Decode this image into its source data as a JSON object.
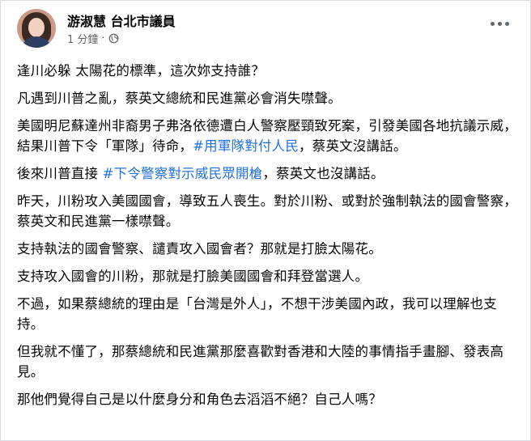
{
  "post": {
    "author": "游淑慧 台北市議員",
    "timestamp": "1 分鐘",
    "separator": "·",
    "privacy_icon": "globe-icon",
    "more_icon": "more-options-icon"
  },
  "paragraphs": [
    {
      "text": "逢川必躲 太陽花的標準，這次妳支持誰？"
    },
    {
      "text": "凡遇到川普之亂，蔡英文總統和民進黨必會消失噤聲。"
    },
    {
      "before": "美國明尼蘇達州非裔男子弗洛依德遭白人警察壓頸致死案，引發美國各地抗議示威，結果川普下令「軍隊」待命，",
      "hashtag": "#用軍隊對付人民",
      "after": "，蔡英文沒講話。"
    },
    {
      "before": "後來川普直接 ",
      "hashtag": "#下令警察對示威民眾開槍",
      "after": "，蔡英文也沒講話。"
    },
    {
      "text": "昨天，川粉攻入美國國會，導致五人喪生。對於川粉、或對於強制執法的國會警察，蔡英文和民進黨一樣噤聲。"
    },
    {
      "text": "支持執法的國會警察、譴責攻入國會者？那就是打臉太陽花。"
    },
    {
      "text": "支持攻入國會的川粉，那就是打臉美國國會和拜登當選人。"
    },
    {
      "text": "不過，如果蔡總統的理由是「台灣是外人」，不想干涉美國內政，我可以理解也支持。"
    },
    {
      "text": "但我就不懂了，那蔡總統和民進黨那麼喜歡對香港和大陸的事情指手畫腳、發表高見。"
    },
    {
      "text": "那他們覺得自己是以什麼身分和角色去滔滔不絕？自己人嗎？"
    }
  ],
  "colors": {
    "text": "#050505",
    "secondary": "#65676b",
    "hashtag": "#216fdb"
  }
}
